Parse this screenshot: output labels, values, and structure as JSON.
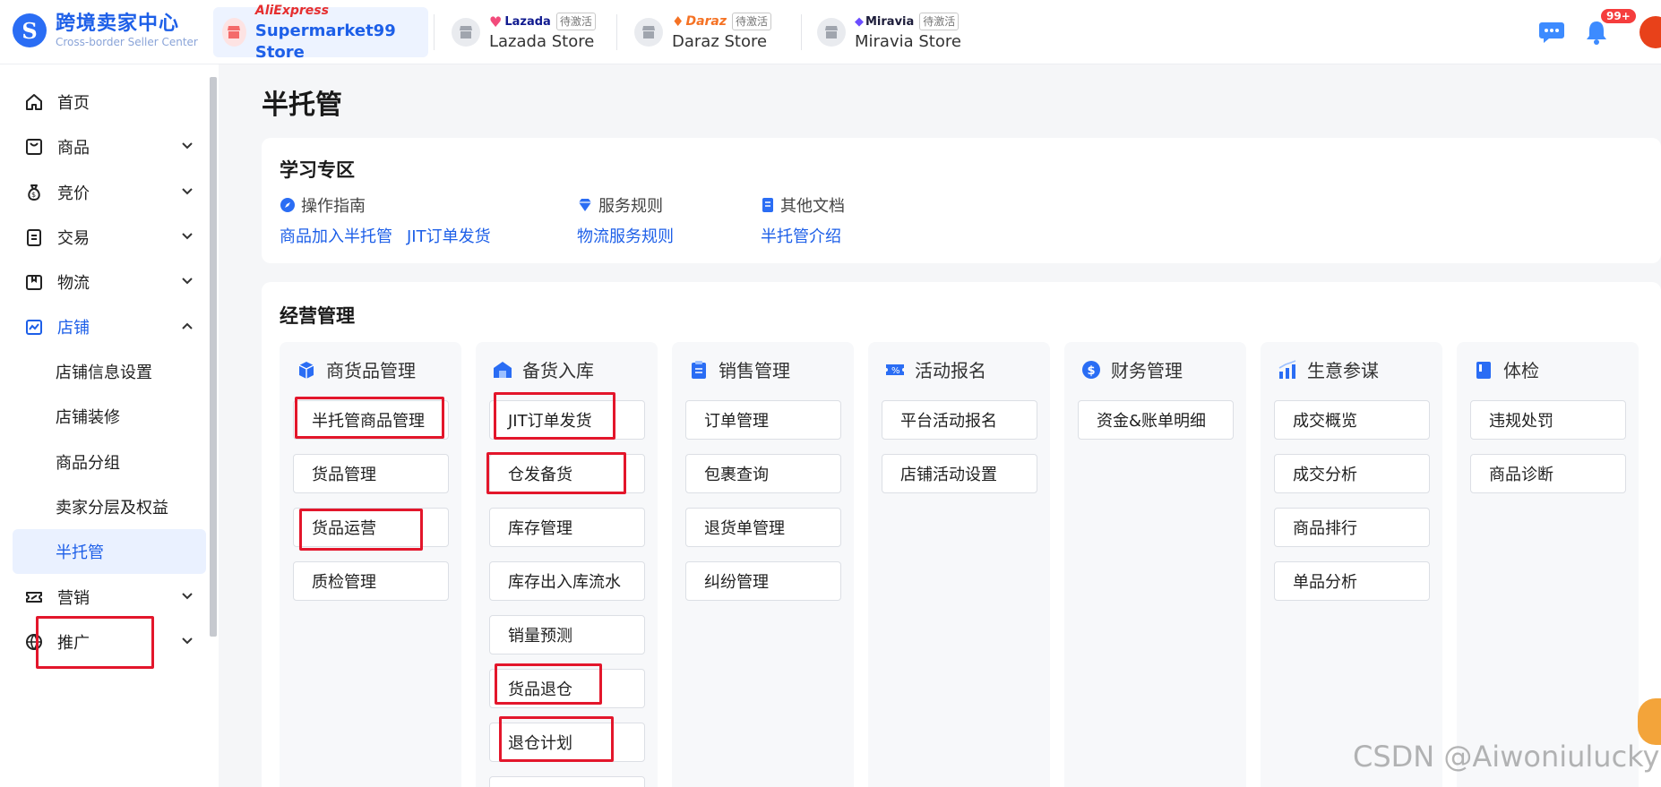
{
  "header": {
    "logo_title": "跨境卖家中心",
    "logo_subtitle": "Cross-border Seller Center",
    "stores": [
      {
        "brand": "AliExpress",
        "name": "Supermarket99 Store",
        "status": "",
        "brand_color": "#e62e2e"
      },
      {
        "brand": "Lazada",
        "name": "Lazada Store",
        "status": "待激活",
        "brand_color": "#101a8f"
      },
      {
        "brand": "Daraz",
        "name": "Daraz Store",
        "status": "待激活",
        "brand_color": "#f57224"
      },
      {
        "brand": "Miravia",
        "name": "Miravia Store",
        "status": "待激活",
        "brand_color": "#1c1c3a"
      }
    ],
    "notification_count": "99+"
  },
  "sidebar": {
    "items": [
      {
        "label": "首页",
        "icon": "home-icon"
      },
      {
        "label": "商品",
        "icon": "bag-icon"
      },
      {
        "label": "竞价",
        "icon": "money-bag-icon"
      },
      {
        "label": "交易",
        "icon": "clipboard-icon"
      },
      {
        "label": "物流",
        "icon": "box-icon"
      },
      {
        "label": "店铺",
        "icon": "store-chart-icon"
      },
      {
        "label": "营销",
        "icon": "ticket-icon"
      },
      {
        "label": "推广",
        "icon": "globe-ad-icon"
      }
    ],
    "store_subitems": [
      "店铺信息设置",
      "店铺装修",
      "商品分组",
      "卖家分层及权益",
      "半托管"
    ]
  },
  "main": {
    "page_title": "半托管",
    "learn": {
      "title": "学习专区",
      "groups": [
        {
          "heading": "操作指南",
          "links": [
            "商品加入半托管",
            "JIT订单发货"
          ]
        },
        {
          "heading": "服务规则",
          "links": [
            "物流服务规则"
          ]
        },
        {
          "heading": "其他文档",
          "links": [
            "半托管介绍"
          ]
        }
      ]
    },
    "ops": {
      "title": "经营管理",
      "columns": [
        {
          "title": "商货品管理",
          "buttons": [
            "半托管商品管理",
            "货品管理",
            "货品运营",
            "质检管理"
          ]
        },
        {
          "title": "备货入库",
          "buttons": [
            "JIT订单发货",
            "仓发备货",
            "库存管理",
            "库存出入库流水",
            "销量预测",
            "货品退仓",
            "退仓计划"
          ]
        },
        {
          "title": "销售管理",
          "buttons": [
            "订单管理",
            "包裹查询",
            "退货单管理",
            "纠纷管理"
          ]
        },
        {
          "title": "活动报名",
          "buttons": [
            "平台活动报名",
            "店铺活动设置"
          ]
        },
        {
          "title": "财务管理",
          "buttons": [
            "资金&账单明细"
          ]
        },
        {
          "title": "生意参谋",
          "buttons": [
            "成交概览",
            "成交分析",
            "商品排行",
            "单品分析"
          ]
        },
        {
          "title": "体检",
          "buttons": [
            "违规处罚",
            "商品诊断"
          ]
        }
      ]
    }
  },
  "watermark": "CSDN @Aiwoniulucky",
  "colors": {
    "accent": "#1d5fe8",
    "highlight": "#e3162b"
  }
}
